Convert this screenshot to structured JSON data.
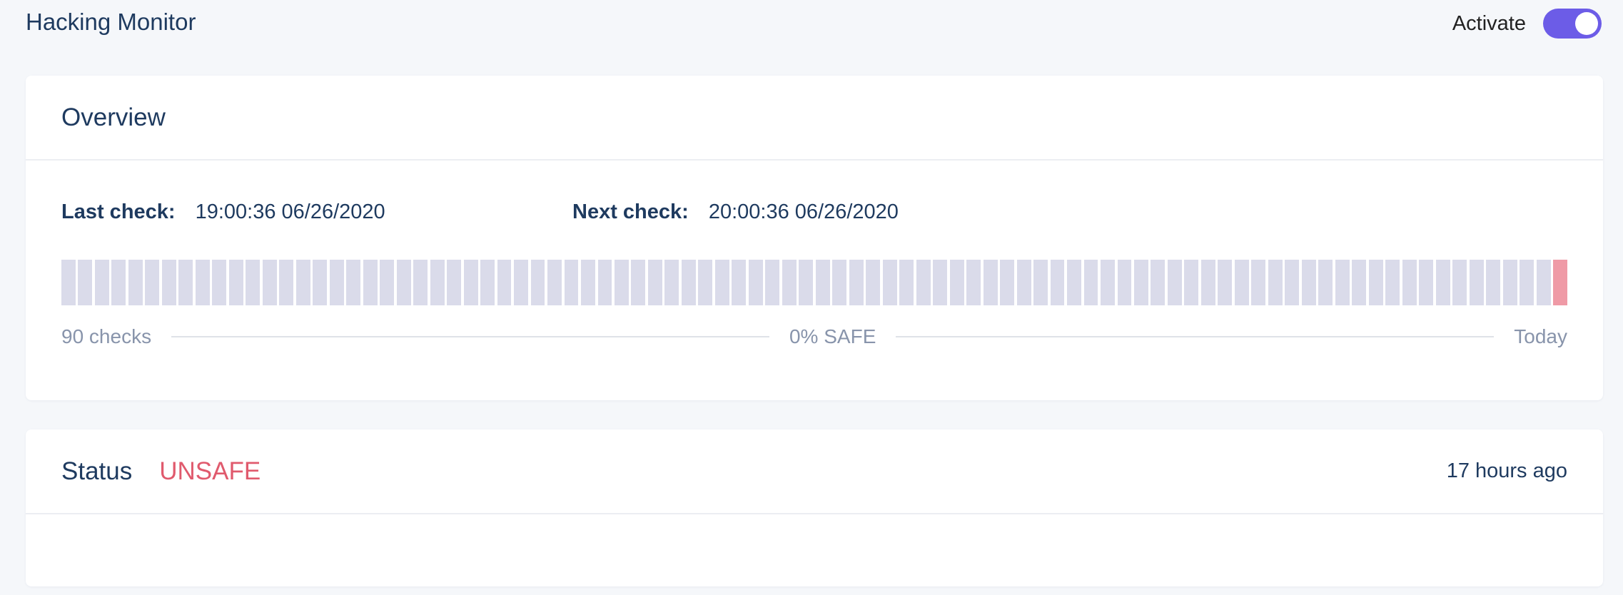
{
  "app": {
    "title": "Hacking Monitor"
  },
  "activate": {
    "label": "Activate",
    "enabled": true,
    "color": "#6c5ce7"
  },
  "overview": {
    "title": "Overview",
    "last_check_label": "Last check:",
    "last_check_value": "19:00:36 06/26/2020",
    "next_check_label": "Next check:",
    "next_check_value": "20:00:36 06/26/2020",
    "bars": {
      "count": 90,
      "statuses": [
        "none",
        "none",
        "none",
        "none",
        "none",
        "none",
        "none",
        "none",
        "none",
        "none",
        "none",
        "none",
        "none",
        "none",
        "none",
        "none",
        "none",
        "none",
        "none",
        "none",
        "none",
        "none",
        "none",
        "none",
        "none",
        "none",
        "none",
        "none",
        "none",
        "none",
        "none",
        "none",
        "none",
        "none",
        "none",
        "none",
        "none",
        "none",
        "none",
        "none",
        "none",
        "none",
        "none",
        "none",
        "none",
        "none",
        "none",
        "none",
        "none",
        "none",
        "none",
        "none",
        "none",
        "none",
        "none",
        "none",
        "none",
        "none",
        "none",
        "none",
        "none",
        "none",
        "none",
        "none",
        "none",
        "none",
        "none",
        "none",
        "none",
        "none",
        "none",
        "none",
        "none",
        "none",
        "none",
        "none",
        "none",
        "none",
        "none",
        "none",
        "none",
        "none",
        "none",
        "none",
        "none",
        "none",
        "none",
        "none",
        "none",
        "unsafe"
      ],
      "colors": {
        "none": "#dadbea",
        "unsafe": "#ef9aa6"
      }
    },
    "legend_left": "90 checks",
    "legend_center": "0% SAFE",
    "legend_right": "Today"
  },
  "status": {
    "title": "Status",
    "value": "UNSAFE",
    "value_color": "#e05a6d",
    "time": "17 hours ago"
  }
}
